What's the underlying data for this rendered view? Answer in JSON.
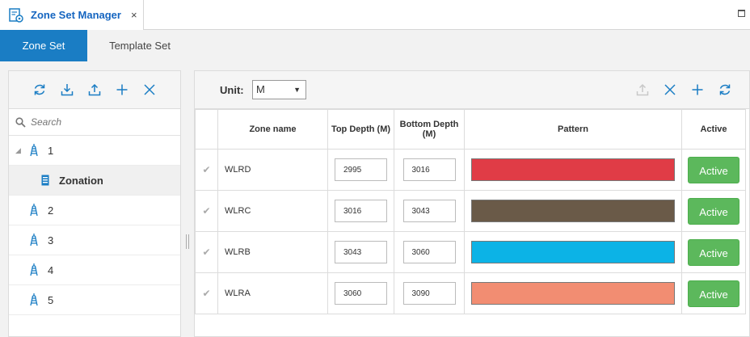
{
  "window": {
    "tab_title": "Zone Set Manager",
    "close_glyph": "×"
  },
  "mode_tabs": [
    {
      "label": "Zone Set",
      "active": true
    },
    {
      "label": "Template Set",
      "active": false
    }
  ],
  "tree": {
    "search_placeholder": "Search",
    "items": [
      {
        "label": "1",
        "expanded": true
      },
      {
        "label": "Zonation",
        "child": true
      },
      {
        "label": "2"
      },
      {
        "label": "3"
      },
      {
        "label": "4"
      },
      {
        "label": "5"
      }
    ]
  },
  "unit": {
    "label": "Unit:",
    "value": "M"
  },
  "table": {
    "headers": {
      "name": "Zone name",
      "top": "Top Depth (M)",
      "bottom": "Bottom Depth (M)",
      "pattern": "Pattern",
      "active": "Active"
    },
    "rows": [
      {
        "name": "WLRD",
        "top": "2995",
        "bottom": "3016",
        "color": "#e03c46",
        "status": "Active"
      },
      {
        "name": "WLRC",
        "top": "3016",
        "bottom": "3043",
        "color": "#6a5a48",
        "status": "Active"
      },
      {
        "name": "WLRB",
        "top": "3043",
        "bottom": "3060",
        "color": "#0cb3e6",
        "status": "Active"
      },
      {
        "name": "WLRA",
        "top": "3060",
        "bottom": "3090",
        "color": "#f28d72",
        "status": "Active"
      }
    ]
  },
  "colors": {
    "accent": "#1a7dc4",
    "active_button": "#5cb85c",
    "icon_blue": "#1a7dc4"
  }
}
